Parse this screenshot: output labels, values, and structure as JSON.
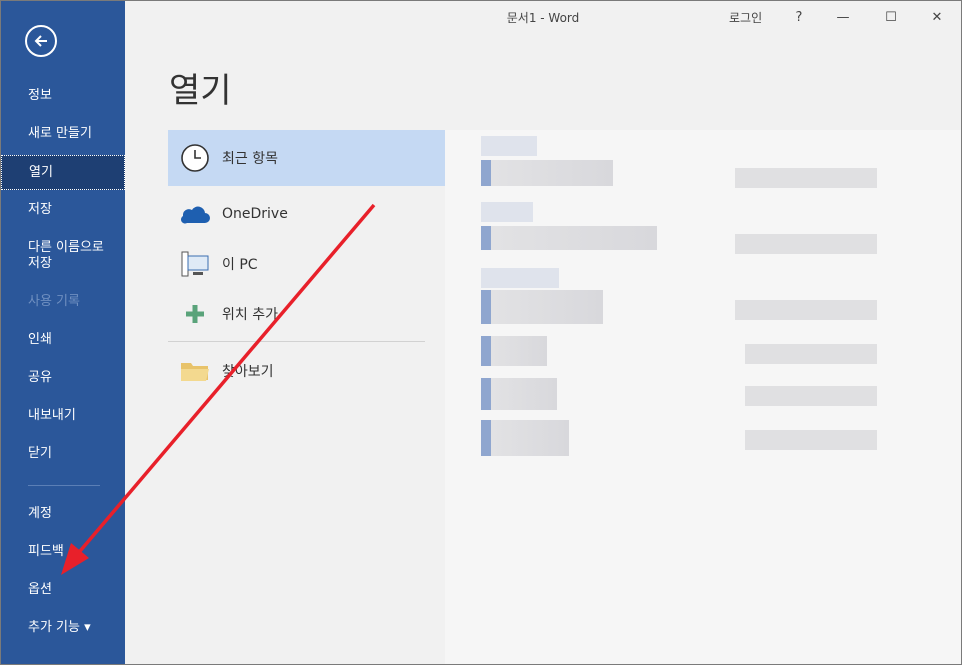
{
  "window": {
    "title": "문서1  -  Word",
    "signin": "로그인",
    "help": "?",
    "minimize": "—",
    "maximize": "☐",
    "close": "✕"
  },
  "sidebar": {
    "items": [
      {
        "label": "정보"
      },
      {
        "label": "새로 만들기"
      },
      {
        "label": "열기"
      },
      {
        "label": "저장"
      },
      {
        "label": "다른 이름으로\n저장"
      },
      {
        "label": "사용 기록"
      },
      {
        "label": "인쇄"
      },
      {
        "label": "공유"
      },
      {
        "label": "내보내기"
      },
      {
        "label": "닫기"
      },
      {
        "label": "계정"
      },
      {
        "label": "피드백"
      },
      {
        "label": "옵션"
      },
      {
        "label": "추가 기능 ▾"
      }
    ]
  },
  "main": {
    "title": "열기",
    "locations": [
      {
        "label": "최근 항목",
        "icon": "clock-icon"
      },
      {
        "label": "OneDrive",
        "icon": "cloud-icon"
      },
      {
        "label": "이 PC",
        "icon": "computer-icon"
      },
      {
        "label": "위치 추가",
        "icon": "plus-icon"
      },
      {
        "label": "찾아보기",
        "icon": "folder-icon"
      }
    ]
  },
  "colors": {
    "sidebar": "#2b579a",
    "selected_location": "#c5d9f3",
    "annotation_arrow": "#e8202a"
  }
}
